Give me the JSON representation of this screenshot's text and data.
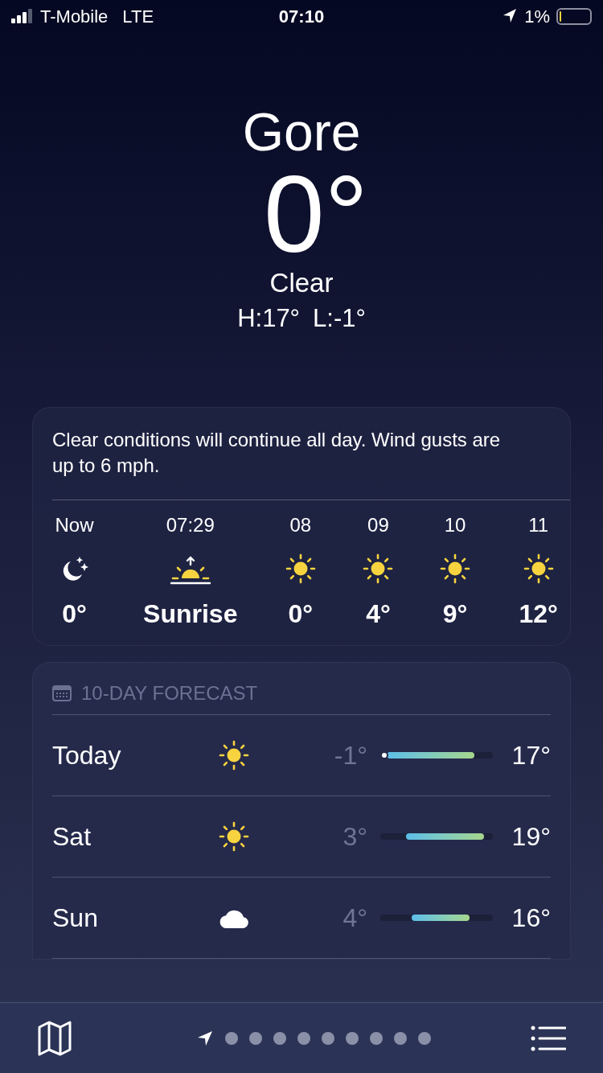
{
  "status_bar": {
    "carrier": "T-Mobile",
    "network": "LTE",
    "time": "07:10",
    "battery": "1%"
  },
  "header": {
    "location": "Gore",
    "temperature": "0°",
    "condition": "Clear",
    "high": "H:17°",
    "low": "L:-1°"
  },
  "hourly_card": {
    "summary": "Clear conditions will continue all day. Wind gusts are up to 6 mph.",
    "hours": [
      {
        "label": "Now",
        "kind": "moon",
        "value": "0°"
      },
      {
        "label": "07:29",
        "kind": "sunrise",
        "value": "Sunrise"
      },
      {
        "label": "08",
        "kind": "sun",
        "value": "0°"
      },
      {
        "label": "09",
        "kind": "sun",
        "value": "4°"
      },
      {
        "label": "10",
        "kind": "sun",
        "value": "9°"
      },
      {
        "label": "11",
        "kind": "sun",
        "value": "12°"
      }
    ]
  },
  "forecast_card": {
    "title": "10-DAY FORECAST",
    "days": [
      {
        "day": "Today",
        "kind": "sun",
        "low": "-1°",
        "high": "17°",
        "current_dot": true
      },
      {
        "day": "Sat",
        "kind": "sun",
        "low": "3°",
        "high": "19°",
        "current_dot": false
      },
      {
        "day": "Sun",
        "kind": "cloud",
        "low": "4°",
        "high": "16°",
        "current_dot": false
      }
    ]
  },
  "page_dots": [
    {
      "kind": "location",
      "selected": true
    },
    {
      "kind": "dot",
      "selected": false
    },
    {
      "kind": "dot",
      "selected": false
    },
    {
      "kind": "dot",
      "selected": false
    },
    {
      "kind": "dot",
      "selected": false
    },
    {
      "kind": "dot",
      "selected": false
    },
    {
      "kind": "dot",
      "selected": false
    },
    {
      "kind": "dot",
      "selected": false
    },
    {
      "kind": "dot",
      "selected": false
    },
    {
      "kind": "dot",
      "selected": false
    }
  ]
}
